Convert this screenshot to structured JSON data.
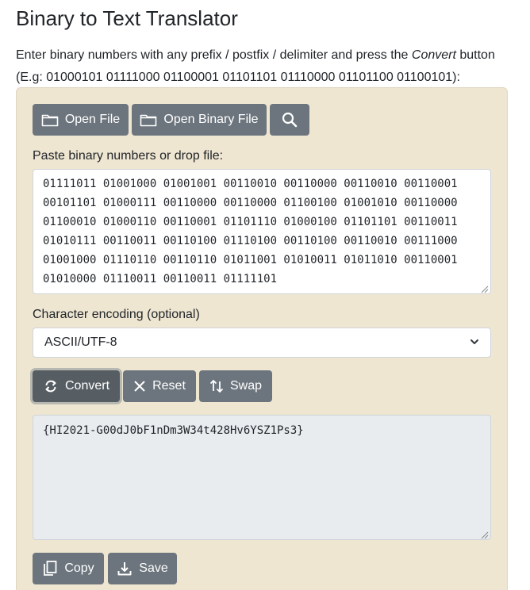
{
  "header": {
    "title": "Binary to Text Translator",
    "description_pre": "Enter binary numbers with any prefix / postfix / delimiter and press the ",
    "description_em": "Convert",
    "description_post": " button",
    "example": "(E.g: 01000101 01111000 01100001 01101101 01110000 01101100 01100101):"
  },
  "toolbar": {
    "open_file": "Open File",
    "open_binary_file": "Open Binary File",
    "search_icon": "search-icon"
  },
  "input": {
    "label": "Paste binary numbers or drop file:",
    "lines": [
      "01111011 01001000 01001001 00110010 00110000 00110010 00110001",
      "00101101 01000111 00110000 00110000 01100100 01001010 00110000",
      "01100010 01000110 00110001 01101110 01000100 01101101 00110011",
      "01010111 00110011 00110100 01110100 00110100 00110010 00111000",
      "01001000 01110110 00110110 01011001 01010011 01011010 00110001",
      "01010000 01110011 00110011 01111101"
    ]
  },
  "encoding": {
    "label": "Character encoding (optional)",
    "selected": "ASCII/UTF-8"
  },
  "actions": {
    "convert": "Convert",
    "reset": "Reset",
    "swap": "Swap"
  },
  "output": {
    "value": "{HI2021-G00dJ0bF1nDm3W34t428Hv6YSZ1Ps3}"
  },
  "footer": {
    "copy": "Copy",
    "save": "Save"
  },
  "colors": {
    "panel": "#efe6d2",
    "button": "#6c757d",
    "button_active": "#565e64",
    "output_bg": "#e9ecef"
  }
}
